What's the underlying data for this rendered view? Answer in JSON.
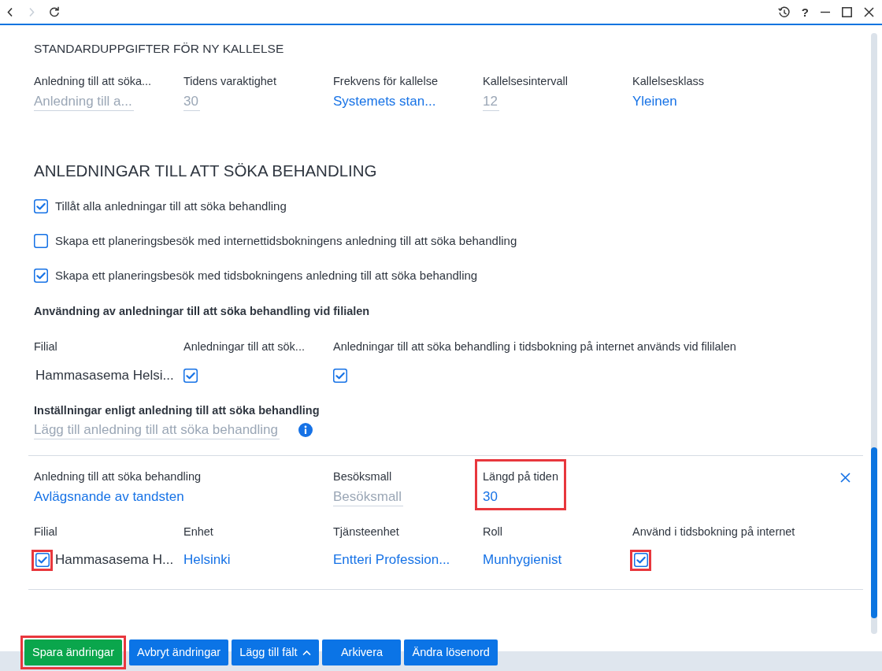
{
  "toolbar": {
    "back": {
      "disabled": false
    },
    "forward": {
      "disabled": true
    },
    "help": "?"
  },
  "defaults": {
    "title": "STANDARDUPPGIFTER FÖR NY KALLELSE",
    "fields": [
      {
        "label": "Anledning till att söka...",
        "kind": "input",
        "placeholder": "Anledning till a..."
      },
      {
        "label": "Tidens varaktighet",
        "kind": "input",
        "placeholder": "30"
      },
      {
        "label": "Frekvens för kallelse",
        "kind": "link",
        "value": "Systemets stan..."
      },
      {
        "label": "Kallelsesintervall",
        "kind": "input",
        "placeholder": "12"
      },
      {
        "label": "Kallelsesklass",
        "kind": "link",
        "value": "Yleinen"
      }
    ]
  },
  "reasons": {
    "title": "ANLEDNINGAR TILL ATT SÖKA BEHANDLING",
    "options": [
      {
        "label": "Tillåt alla anledningar till att söka behandling",
        "checked": true
      },
      {
        "label": "Skapa ett planeringsbesök med internettidsbokningens anledning till att söka behandling",
        "checked": false
      },
      {
        "label": "Skapa ett planeringsbesök med tidsbokningens anledning till att söka behandling",
        "checked": true
      }
    ],
    "branch_usage": {
      "title": "Användning av anledningar till att söka behandling vid filialen",
      "columns": [
        "Filial",
        "Anledningar till att sök...",
        "Anledningar till att söka behandling i tidsbokning på internet används vid fililalen"
      ],
      "rows": [
        {
          "branch": "Hammasasema Helsi...",
          "reasons_allowed": true,
          "internet_booking": true
        }
      ]
    },
    "settings": {
      "title": "Inställningar enligt anledning till att söka behandling",
      "placeholder": "Lägg till anledning till att söka behandling"
    }
  },
  "reason_entry": {
    "fields": [
      {
        "label": "Anledning till att söka behandling",
        "kind": "link",
        "value": "Avlägsnande av tandsten",
        "highlighted": false
      },
      {
        "label": "Besöksmall",
        "kind": "input",
        "placeholder": "Besöksmall",
        "highlighted": false
      },
      {
        "label": "Längd på tiden",
        "kind": "link",
        "value": "30",
        "highlighted": true
      }
    ],
    "columns": [
      "Filial",
      "Enhet",
      "Tjänsteenhet",
      "Roll",
      "Använd i tidsbokning på internet"
    ],
    "rows": [
      {
        "branch": {
          "name": "Hammasasema H...",
          "checked": true,
          "highlighted": true
        },
        "unit": "Helsinki",
        "service_unit": "Entteri Profession...",
        "role": "Munhygienist",
        "internet_booking": {
          "checked": true,
          "highlighted": true
        }
      }
    ]
  },
  "actions": [
    {
      "label": "Spara ändringar",
      "kind": "success",
      "highlighted": true
    },
    {
      "label": "Avbryt ändringar",
      "kind": "primary",
      "highlighted": false
    },
    {
      "label": "Lägg till fält",
      "kind": "dropdown",
      "highlighted": false
    },
    {
      "label": "Arkivera",
      "kind": "primary",
      "highlighted": false
    },
    {
      "label": "Ändra lösenord",
      "kind": "primary",
      "highlighted": false
    }
  ]
}
